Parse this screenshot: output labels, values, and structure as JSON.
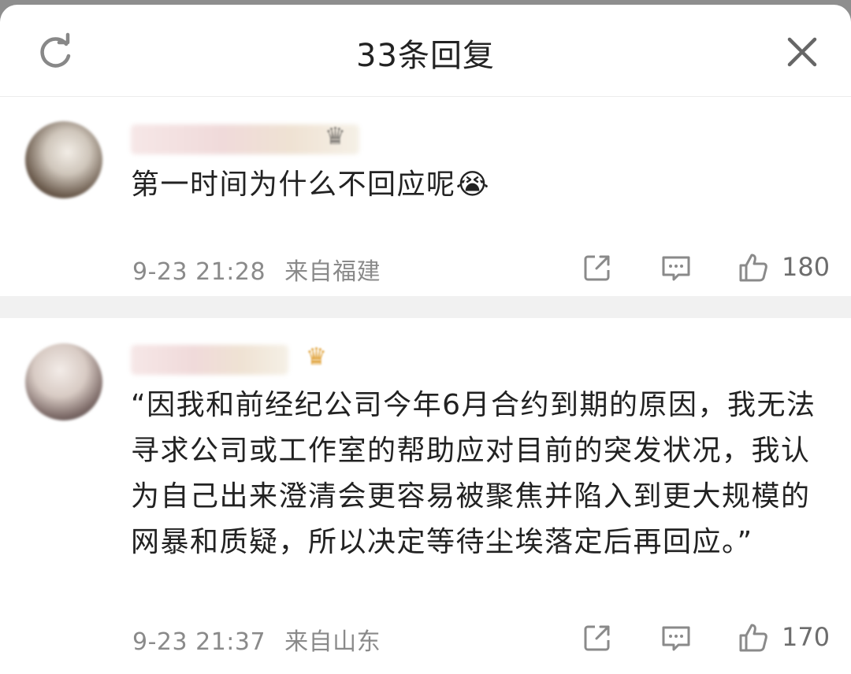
{
  "header": {
    "title": "33条回复",
    "refresh_icon": "refresh-icon",
    "close_icon": "close-icon"
  },
  "comments": [
    {
      "text": "第一时间为什么不回应呢",
      "emoji": "😭",
      "time": "9-23 21:28",
      "location": "来自福建",
      "likes": "180"
    },
    {
      "text": "“因我和前经纪公司今年6月合约到期的原因，我无法寻求公司或工作室的帮助应对目前的突发状况，我认为自己出来澄清会更容易被聚焦并陷入到更大规模的网暴和质疑，所以决定等待尘埃落定后再回应。”",
      "badge_icon": "crown-icon",
      "time": "9-23 21:37",
      "location": "来自山东",
      "likes": "170"
    }
  ],
  "colors": {
    "text": "#222222",
    "meta": "#8a8a8a",
    "divider": "#f1f1f1",
    "icon": "#8a8a8a"
  }
}
